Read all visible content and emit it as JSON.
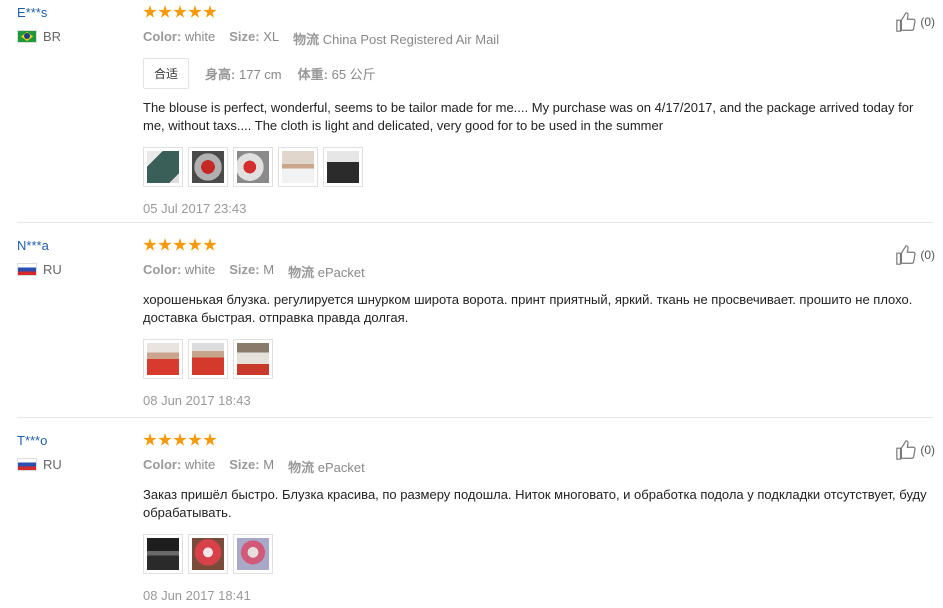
{
  "labels": {
    "color": "Color:",
    "size": "Size:",
    "logistics": "物流",
    "height": "身高:",
    "weight": "体重:"
  },
  "reviews": [
    {
      "user": "E***s",
      "country": "BR",
      "rating": 5,
      "color": "white",
      "size": "XL",
      "logistics": "China Post Registered Air Mail",
      "fit": "合适",
      "height": "177 cm",
      "weight": "65 公斤",
      "text": "The blouse is perfect, wonderful, seems to be tailor made for me.... My purchase was on 4/17/2017, and the package arrived today for me, without taxs.... The cloth is light and delicated, very good for to be used in the summer",
      "photos": 5,
      "date": "05 Jul 2017 23:43",
      "likes": "(0)"
    },
    {
      "user": "N***a",
      "country": "RU",
      "rating": 5,
      "color": "white",
      "size": "M",
      "logistics": "ePacket",
      "text": "хорошенькая блузка. регулируется шнурком широта ворота. принт приятный, яркий. ткань не просвечивает. прошито не плохо. доставка быстрая. отправка правда долгая.",
      "photos": 3,
      "date": "08 Jun 2017 18:43",
      "likes": "(0)"
    },
    {
      "user": "T***o",
      "country": "RU",
      "rating": 5,
      "color": "white",
      "size": "M",
      "logistics": "ePacket",
      "text": "Заказ пришёл быстро. Блузка красива, по размеру подошла. Ниток многовато, и обработка подола у подкладки отсутствует, буду обрабатывать.",
      "photos": 3,
      "date": "08 Jun 2017 18:41",
      "likes": "(0)"
    }
  ],
  "colors": {
    "link": "#1f5fa8",
    "star": "#f59a0a",
    "muted": "#999999"
  },
  "icons": {
    "like": "thumbs-up-icon"
  }
}
